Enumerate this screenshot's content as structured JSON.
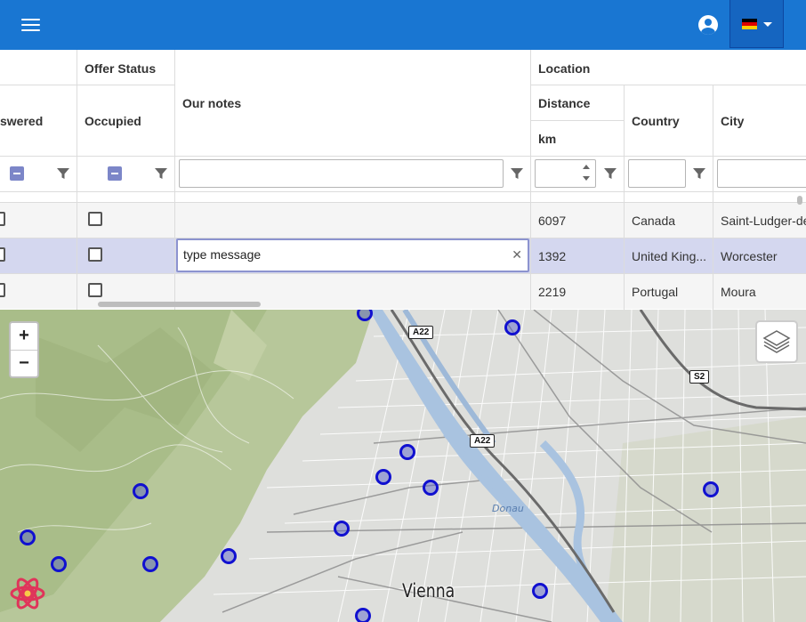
{
  "header": {
    "menu_icon": "hamburger-menu-icon",
    "account_icon": "account-circle-icon",
    "language": {
      "flag": "germany-flag-icon",
      "colors": [
        "#000000",
        "#dd0000",
        "#ffce00"
      ]
    }
  },
  "grid": {
    "groups": {
      "offer_status": "Offer Status",
      "location": "Location"
    },
    "columns": {
      "answered": "swered",
      "occupied": "Occupied",
      "our_notes": "Our notes",
      "distance": "Distance",
      "distance_unit": "km",
      "country": "Country",
      "city": "City"
    },
    "rows": [
      {
        "distance": "6097",
        "country": "Canada",
        "city": "Saint-Ludger-de",
        "selected": false
      },
      {
        "distance": "1392",
        "country": "United King...",
        "city": "Worcester",
        "selected": true,
        "note": "type message"
      },
      {
        "distance": "2219",
        "country": "Portugal",
        "city": "Moura",
        "selected": false
      }
    ],
    "selected_row_color": "#d4d7ef"
  },
  "map": {
    "zoom_in": "+",
    "zoom_out": "−",
    "layers_icon": "layers-icon",
    "road_labels": [
      "A22",
      "A22",
      "S2"
    ],
    "city_label": "Vienna",
    "river_label": "Donau",
    "marker_color": "#1010d0",
    "logo_icon": "react-atom-logo-icon"
  }
}
